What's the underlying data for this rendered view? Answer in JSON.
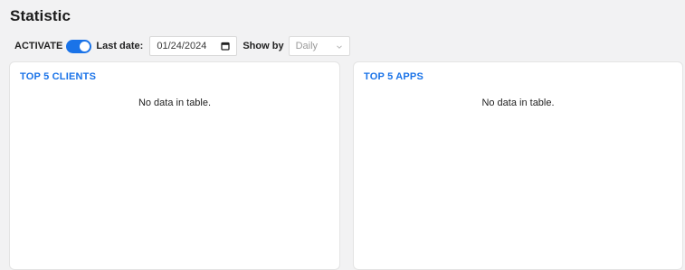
{
  "page": {
    "title": "Statistic"
  },
  "toolbar": {
    "activate_label": "ACTIVATE",
    "activate_on": true,
    "last_date_label": "Last date:",
    "last_date_value": "01/24/2024",
    "show_by_label": "Show by",
    "show_by_value": "Daily",
    "accent_color": "#1a73e8",
    "date_icon": "calendar-icon",
    "select_icon": "chevron-down-icon"
  },
  "panels": [
    {
      "title": "TOP 5 CLIENTS",
      "empty_text": "No data in table."
    },
    {
      "title": "TOP 5 APPS",
      "empty_text": "No data in table."
    }
  ]
}
